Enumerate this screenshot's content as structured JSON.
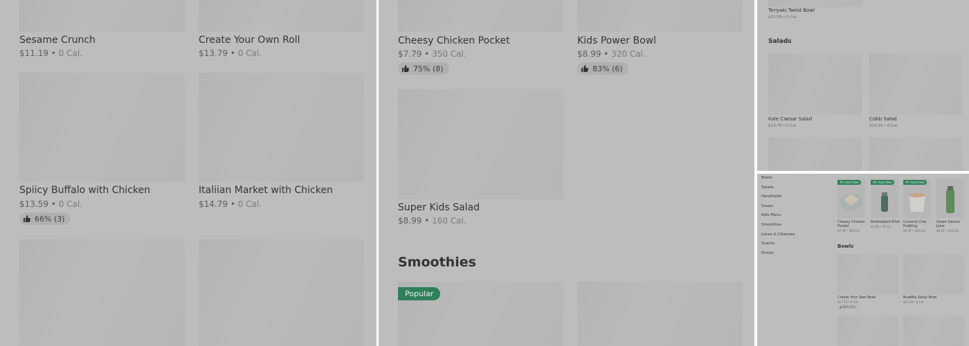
{
  "panel1": {
    "items": [
      {
        "name": "Sesame Crunch",
        "price": "$11.19",
        "cal": "0 Cal."
      },
      {
        "name": "Create Your Own Roll",
        "price": "$13.79",
        "cal": "0 Cal."
      },
      {
        "name": "Spiicy Buffalo with Chicken",
        "price": "$13.59",
        "cal": "0 Cal.",
        "rating": "66% (3)"
      },
      {
        "name": "Italiian Market with Chicken",
        "price": "$14.79",
        "cal": "0 Cal."
      }
    ]
  },
  "panel2": {
    "items": [
      {
        "name": "Cheesy Chicken Pocket",
        "price": "$7.79",
        "cal": "350 Cal.",
        "rating": "75% (8)"
      },
      {
        "name": "Kids Power Bowl",
        "price": "$8.99",
        "cal": "320 Cal.",
        "rating": "83% (6)"
      },
      {
        "name": "Super Kids Salad",
        "price": "$8.99",
        "cal": "160 Cal."
      }
    ],
    "section": "Smoothies",
    "badge": "Popular"
  },
  "panel3": {
    "top_item": {
      "name": "Teriyaki Twiist Bowl",
      "price": "$12.59",
      "cal": "0 Cal."
    },
    "section": "Salads",
    "items": [
      {
        "name": "Kale Caesar Salad",
        "price": "$13.79",
        "cal": "0 Cal."
      },
      {
        "name": "Cobb Salad",
        "price": "$14.39",
        "cal": "0 Cal."
      }
    ]
  },
  "panel4": {
    "sidebar": [
      "Bowls",
      "Salads",
      "Handhelds",
      "Soups",
      "Kids Menu",
      "Smoothies",
      "Juices & Cleanses",
      "Snacks",
      "Drinks"
    ],
    "featured": [
      {
        "badge": "#1 most liked",
        "name": "Cheesy Chicken Pocket",
        "meta": "$7.79 • 350 Cal."
      },
      {
        "badge": "#2 most liked",
        "name": "Antioxidant Elixir",
        "meta": "$4.40 • 10 Cal."
      },
      {
        "badge": "#3 most liked",
        "name": "Coconut Chia Pudding",
        "meta": "$6.59 • 320 Cal."
      },
      {
        "badge": "",
        "name": "Green Genius Juice",
        "meta": "$6.19 • 120 Cal."
      }
    ],
    "section": "Bowls",
    "bowls": [
      {
        "name": "Create Your Own Bowl",
        "meta": "$17.79 • 0 Cal.",
        "rating": "88% (27)"
      },
      {
        "name": "Buddha Satay Bowl",
        "meta": "$13.19 • 0 Cal."
      }
    ]
  },
  "colors": {
    "overlay": "#bdbdbd",
    "badge_green": "#2f7f5a"
  },
  "icons": {
    "rating": "thumbs-up-icon"
  }
}
